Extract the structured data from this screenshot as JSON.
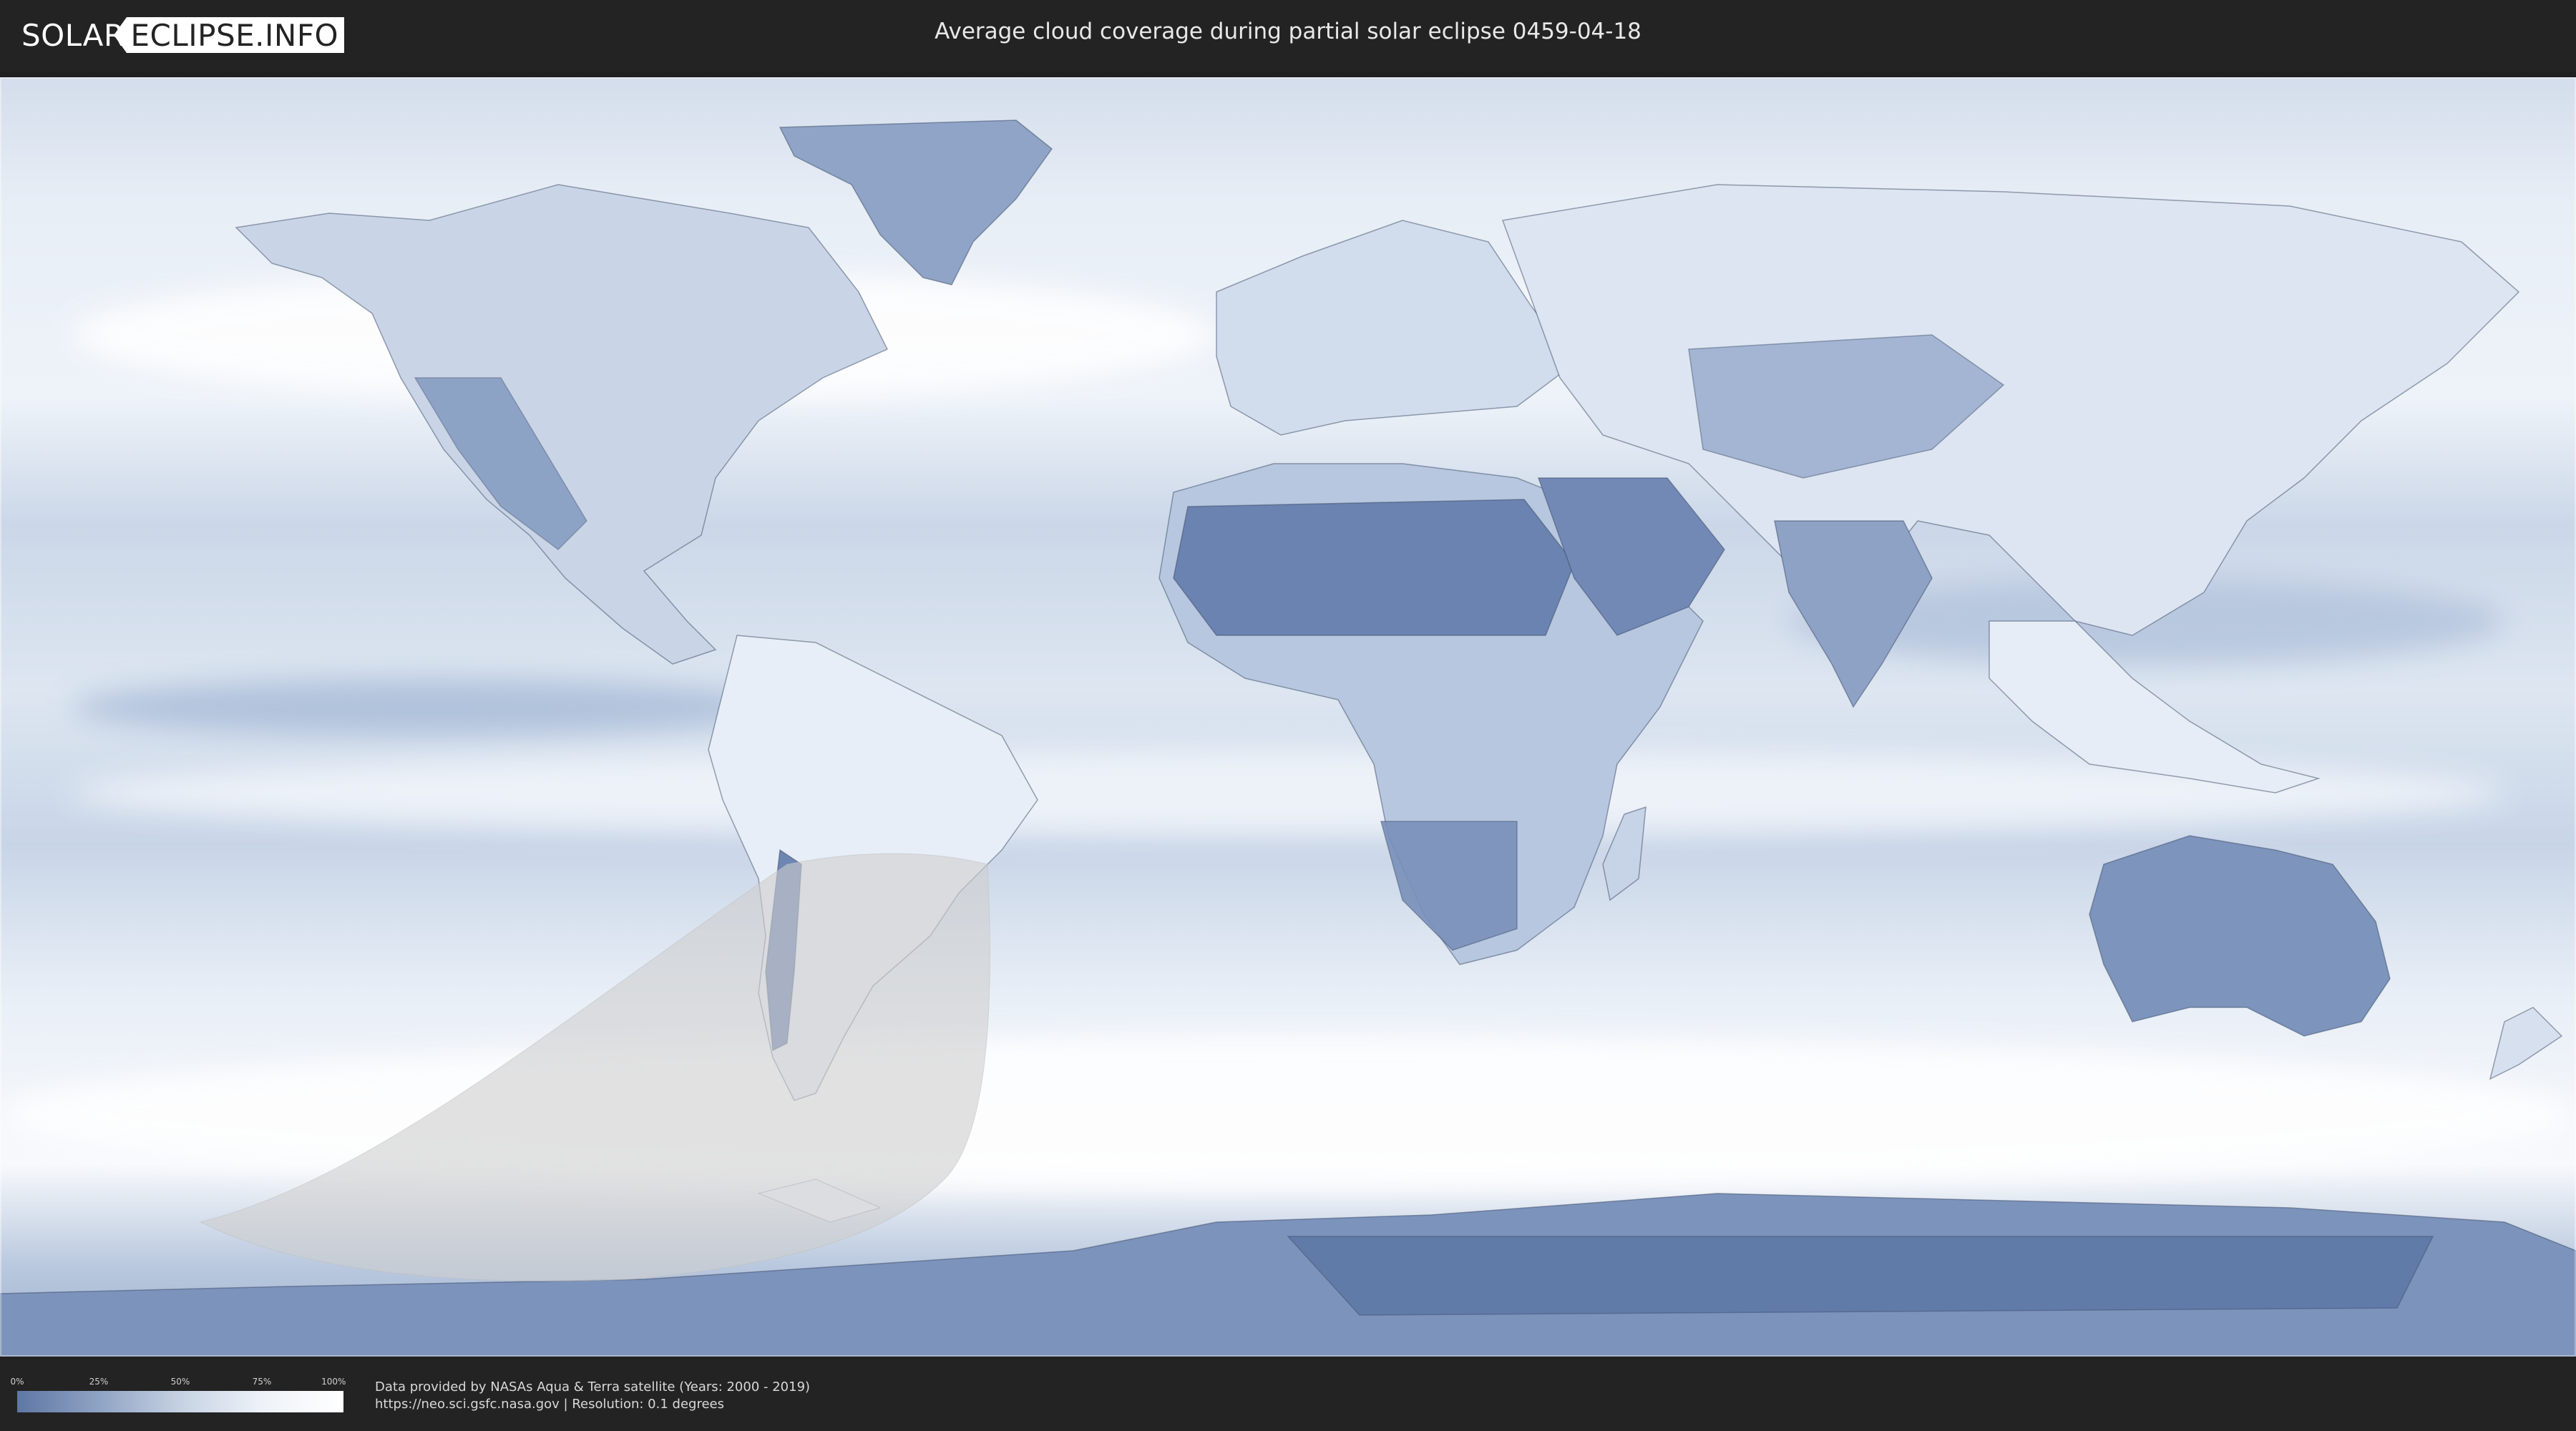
{
  "header": {
    "logo_part1": "SOLAR",
    "logo_part2": "ECLIPSE.INFO",
    "title": "Average cloud coverage during partial solar eclipse 0459-04-18"
  },
  "legend": {
    "ticks": [
      "0%",
      "25%",
      "50%",
      "75%",
      "100%"
    ],
    "gradient_colors": [
      "#5e77a4",
      "#8fa3c4",
      "#c6d2e3",
      "#eef2f8",
      "#ffffff"
    ]
  },
  "footer": {
    "credit_line1": "Data provided by NASAs Aqua & Terra satellite (Years: 2000 - 2019)",
    "credit_line2": "https://neo.sci.gsfc.nasa.gov | Resolution: 0.1 degrees"
  },
  "map": {
    "projection": "equirectangular",
    "colors": {
      "clear_sky": "#6d86b2",
      "cloudy": "#f4f7fb",
      "eclipse_zone": "#cfcfcf",
      "borders": "#3b4a66"
    }
  }
}
